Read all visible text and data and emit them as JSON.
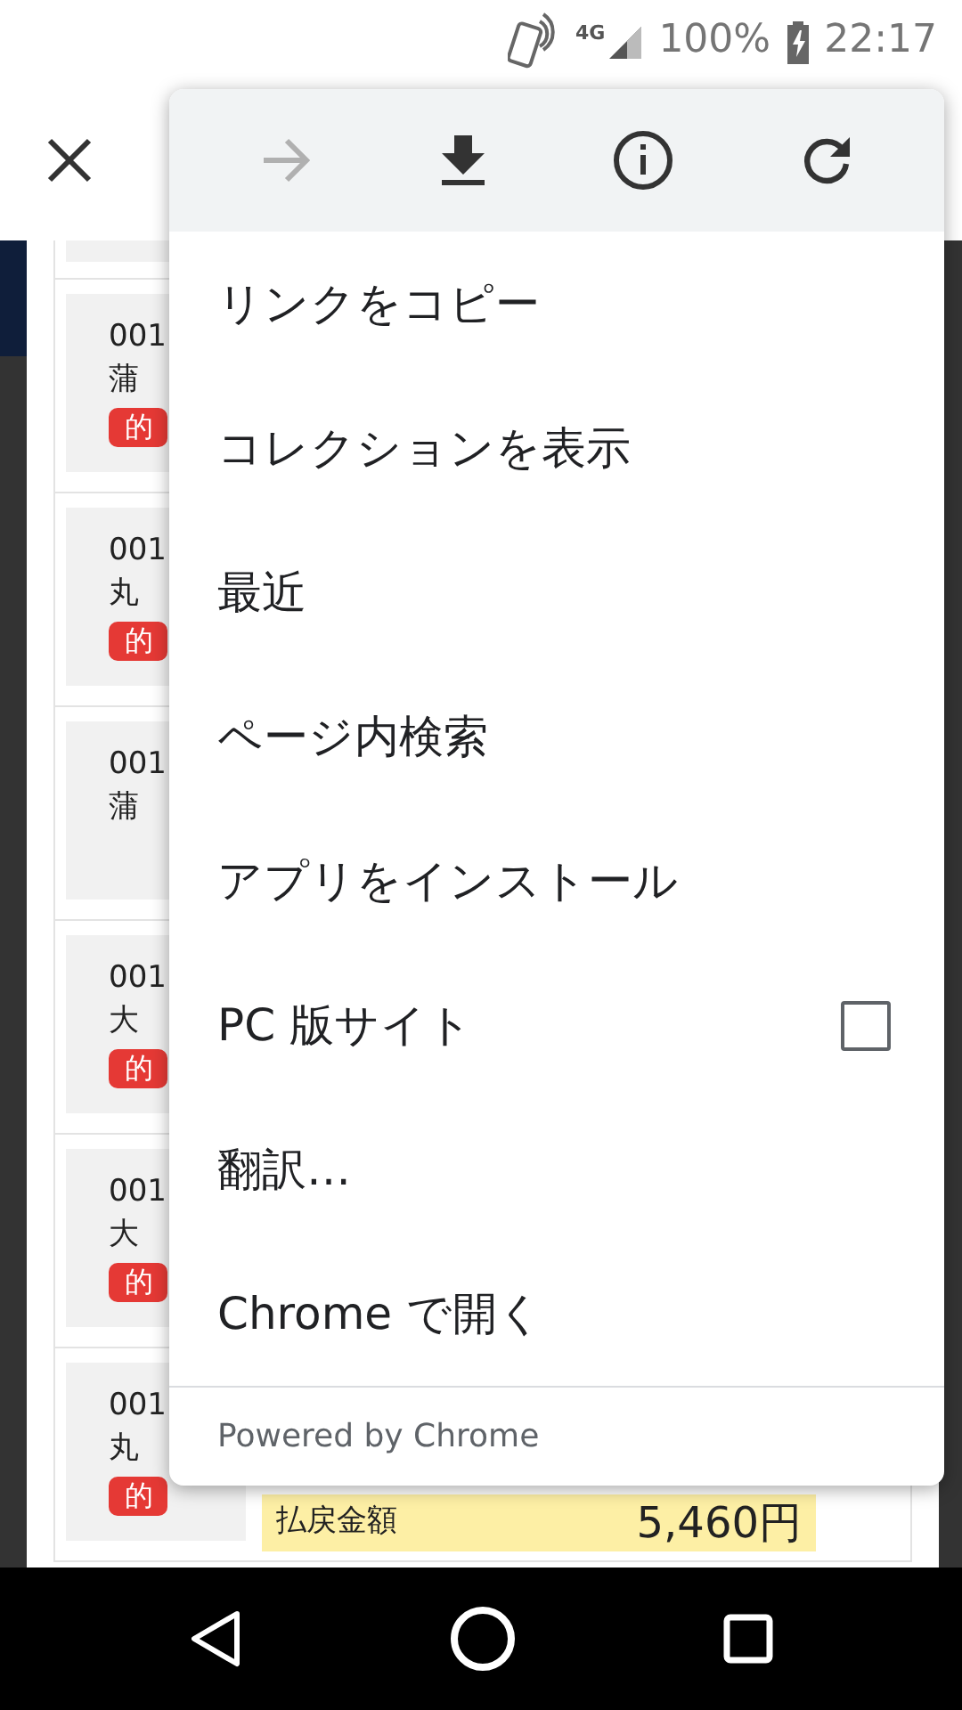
{
  "status_bar": {
    "network": "4G",
    "battery": "100%",
    "time": "22:17"
  },
  "page": {
    "cards": [
      {
        "number": "001",
        "name": "蒲",
        "badge": "的"
      },
      {
        "number": "001",
        "name": "丸",
        "badge": "的"
      },
      {
        "number": "001",
        "name": "蒲"
      },
      {
        "number": "001",
        "name": "大",
        "badge": "的"
      },
      {
        "number": "001",
        "name": "大",
        "badge": "的"
      },
      {
        "number": "001",
        "name": "丸",
        "badge": "的",
        "payout": {
          "label": "払戻金額",
          "amount": "5,460円"
        }
      }
    ]
  },
  "menu": {
    "icons": [
      {
        "kind": "forward",
        "disabled": true
      },
      {
        "kind": "download",
        "disabled": false
      },
      {
        "kind": "info",
        "disabled": false
      },
      {
        "kind": "reload",
        "disabled": false
      }
    ],
    "items": [
      {
        "kind": "plain",
        "label": "リンクをコピー"
      },
      {
        "kind": "plain",
        "label": "コレクションを表示"
      },
      {
        "kind": "plain",
        "label": "最近"
      },
      {
        "kind": "plain",
        "label": "ページ内検索"
      },
      {
        "kind": "plain",
        "label": "アプリをインストール"
      },
      {
        "kind": "checkbox",
        "label": "PC 版サイト",
        "checked": false
      },
      {
        "kind": "plain",
        "label": "翻訳…"
      },
      {
        "kind": "plain",
        "label": "Chrome で開く"
      }
    ],
    "footer": "Powered by Chrome"
  }
}
